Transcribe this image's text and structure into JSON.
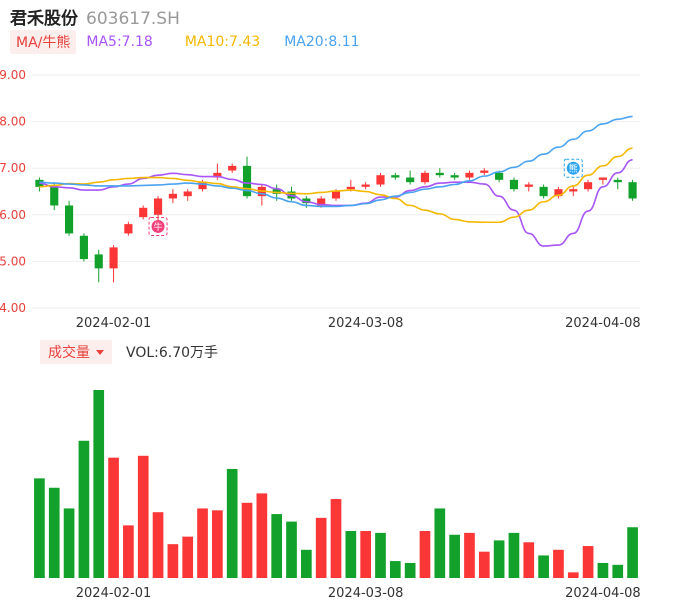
{
  "header": {
    "name": "君禾股份",
    "code": "603617.SH"
  },
  "ma_legend": {
    "label": "MA/牛熊",
    "items": [
      {
        "text": "MA5:7.18",
        "color": "#a855f7"
      },
      {
        "text": "MA10:7.43",
        "color": "#f5b800"
      },
      {
        "text": "MA20:8.11",
        "color": "#4aa3f0"
      }
    ]
  },
  "volume_legend": {
    "label": "成交量",
    "value": "VOL:6.70万手"
  },
  "markers": {
    "bull": "牛",
    "bear": "熊"
  },
  "colors": {
    "up": "#fb3636",
    "down": "#12a12a",
    "grid": "#eeeeee"
  },
  "chart_data": [
    {
      "type": "candlestick",
      "y_ticks": [
        "9.00",
        "8.00",
        "7.00",
        "6.00",
        "5.00",
        "4.00"
      ],
      "ylim": [
        4.0,
        9.0
      ],
      "x_tick_labels": [
        "2024-02-01",
        "2024-03-08",
        "2024-04-08"
      ],
      "x_tick_index": [
        5,
        22,
        38
      ],
      "candles": [
        [
          6.75,
          6.6,
          6.8,
          6.5
        ],
        [
          6.6,
          6.2,
          6.7,
          6.1
        ],
        [
          6.2,
          5.6,
          6.3,
          5.55
        ],
        [
          5.55,
          5.05,
          5.6,
          5.0
        ],
        [
          5.15,
          4.85,
          5.25,
          4.55
        ],
        [
          4.85,
          5.3,
          5.35,
          4.55
        ],
        [
          5.6,
          5.8,
          5.85,
          5.55
        ],
        [
          5.95,
          6.15,
          6.2,
          5.9
        ],
        [
          6.0,
          6.35,
          6.4,
          5.85
        ],
        [
          6.35,
          6.45,
          6.55,
          6.25
        ],
        [
          6.4,
          6.5,
          6.55,
          6.3
        ],
        [
          6.55,
          6.7,
          6.75,
          6.5
        ],
        [
          6.8,
          6.9,
          7.1,
          6.75
        ],
        [
          6.95,
          7.05,
          7.1,
          6.9
        ],
        [
          7.05,
          6.4,
          7.25,
          6.35
        ],
        [
          6.4,
          6.6,
          6.65,
          6.2
        ],
        [
          6.55,
          6.45,
          6.65,
          6.3
        ],
        [
          6.5,
          6.35,
          6.6,
          6.3
        ],
        [
          6.35,
          6.25,
          6.4,
          6.15
        ],
        [
          6.2,
          6.35,
          6.4,
          6.15
        ],
        [
          6.35,
          6.5,
          6.55,
          6.3
        ],
        [
          6.55,
          6.6,
          6.75,
          6.5
        ],
        [
          6.6,
          6.65,
          6.7,
          6.55
        ],
        [
          6.65,
          6.85,
          6.9,
          6.6
        ],
        [
          6.85,
          6.8,
          6.9,
          6.75
        ],
        [
          6.8,
          6.7,
          6.95,
          6.65
        ],
        [
          6.7,
          6.9,
          6.95,
          6.65
        ],
        [
          6.9,
          6.85,
          7.0,
          6.8
        ],
        [
          6.85,
          6.8,
          6.9,
          6.75
        ],
        [
          6.8,
          6.9,
          6.95,
          6.75
        ],
        [
          6.9,
          6.95,
          7.0,
          6.85
        ],
        [
          6.9,
          6.75,
          6.95,
          6.7
        ],
        [
          6.75,
          6.55,
          6.8,
          6.5
        ],
        [
          6.6,
          6.65,
          6.7,
          6.5
        ],
        [
          6.6,
          6.4,
          6.65,
          6.35
        ],
        [
          6.4,
          6.55,
          6.6,
          6.35
        ],
        [
          6.5,
          6.55,
          6.6,
          6.4
        ],
        [
          6.55,
          6.7,
          6.75,
          6.5
        ],
        [
          6.75,
          6.8,
          6.8,
          6.65
        ],
        [
          6.75,
          6.7,
          6.8,
          6.55
        ],
        [
          6.7,
          6.35,
          6.75,
          6.3
        ]
      ],
      "series": [
        {
          "name": "MA5",
          "color": "#a855f7",
          "values": [
            6.68,
            6.6,
            6.58,
            6.53,
            6.53,
            6.6,
            6.66,
            6.78,
            6.85,
            6.89,
            6.86,
            6.82,
            6.82,
            6.76,
            6.68,
            6.65,
            6.56,
            6.41,
            6.28,
            6.22,
            6.2,
            6.2,
            6.25,
            6.38,
            6.38,
            6.52,
            6.6,
            6.68,
            6.7,
            6.7,
            6.66,
            6.4,
            6.1,
            5.6,
            5.33,
            5.35,
            5.6,
            6.08,
            6.6,
            6.9,
            7.18
          ]
        },
        {
          "name": "MA10",
          "color": "#f5b800",
          "values": [
            6.6,
            6.63,
            6.67,
            6.66,
            6.7,
            6.75,
            6.78,
            6.8,
            6.8,
            6.78,
            6.74,
            6.7,
            6.67,
            6.6,
            6.56,
            6.51,
            6.48,
            6.46,
            6.45,
            6.48,
            6.51,
            6.53,
            6.5,
            6.43,
            6.35,
            6.2,
            6.1,
            6.02,
            5.9,
            5.85,
            5.84,
            5.84,
            5.95,
            6.1,
            6.28,
            6.42,
            6.62,
            6.85,
            7.05,
            7.25,
            7.43
          ]
        },
        {
          "name": "MA20",
          "color": "#4aa3f0",
          "values": [
            6.7,
            6.68,
            6.66,
            6.64,
            6.62,
            6.62,
            6.62,
            6.63,
            6.64,
            6.66,
            6.68,
            6.66,
            6.62,
            6.57,
            6.52,
            6.45,
            6.36,
            6.28,
            6.2,
            6.18,
            6.18,
            6.2,
            6.24,
            6.32,
            6.4,
            6.48,
            6.55,
            6.6,
            6.65,
            6.73,
            6.83,
            6.92,
            7.02,
            7.15,
            7.3,
            7.45,
            7.62,
            7.8,
            7.95,
            8.05,
            8.11
          ]
        }
      ],
      "signals": [
        {
          "index": 8,
          "label": "牛",
          "price": 5.75
        },
        {
          "index": 36,
          "label": "熊",
          "price": 7.0
        }
      ]
    },
    {
      "type": "bar",
      "ylim": [
        0,
        1.0
      ],
      "values": [
        0.53,
        0.48,
        0.37,
        0.73,
        1.0,
        0.64,
        0.28,
        0.65,
        0.35,
        0.18,
        0.22,
        0.37,
        0.36,
        0.58,
        0.4,
        0.45,
        0.34,
        0.3,
        0.15,
        0.32,
        0.42,
        0.25,
        0.25,
        0.24,
        0.09,
        0.08,
        0.25,
        0.37,
        0.23,
        0.24,
        0.14,
        0.2,
        0.24,
        0.19,
        0.12,
        0.15,
        0.03,
        0.17,
        0.08,
        0.07,
        0.27
      ],
      "colors_per_bar": [
        "down",
        "down",
        "down",
        "down",
        "down",
        "up",
        "up",
        "up",
        "up",
        "up",
        "up",
        "up",
        "up",
        "down",
        "up",
        "up",
        "down",
        "down",
        "down",
        "up",
        "up",
        "down",
        "up",
        "down",
        "down",
        "down",
        "up",
        "down",
        "down",
        "up",
        "up",
        "down",
        "down",
        "up",
        "down",
        "up",
        "up",
        "up",
        "down",
        "down",
        "down"
      ]
    }
  ]
}
